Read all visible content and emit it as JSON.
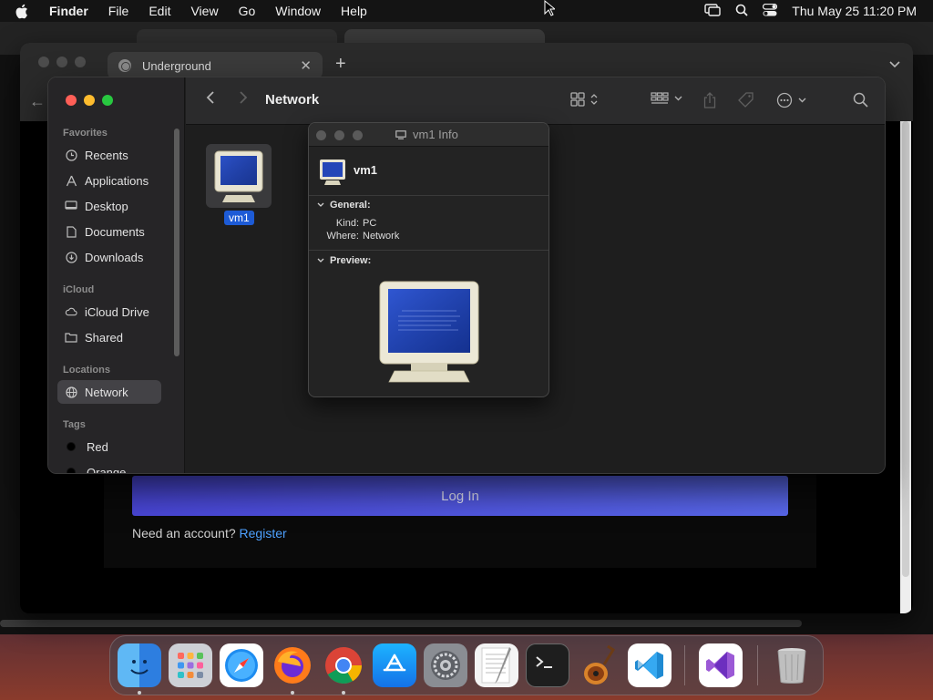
{
  "menubar": {
    "app_name": "Finder",
    "menus": [
      "File",
      "Edit",
      "View",
      "Go",
      "Window",
      "Help"
    ],
    "clock": "Thu May 25  11:20 PM"
  },
  "browser": {
    "tab_title": "Underground",
    "login_button": "Log In",
    "need_account": "Need an account?",
    "register_link": "Register"
  },
  "finder": {
    "title": "Network",
    "sidebar": {
      "favorites_heading": "Favorites",
      "favorites": [
        "Recents",
        "Applications",
        "Desktop",
        "Documents",
        "Downloads"
      ],
      "icloud_heading": "iCloud",
      "icloud": [
        "iCloud Drive",
        "Shared"
      ],
      "locations_heading": "Locations",
      "locations": [
        "Network"
      ],
      "tags_heading": "Tags",
      "tags": [
        {
          "label": "Red",
          "color": "#000000"
        },
        {
          "label": "Orange",
          "color": "#000000"
        }
      ]
    },
    "item_label": "vm1"
  },
  "info": {
    "title": "vm1 Info",
    "name": "vm1",
    "general_heading": "General:",
    "kind_key": "Kind:",
    "kind_value": "PC",
    "where_key": "Where:",
    "where_value": "Network",
    "preview_heading": "Preview:"
  },
  "dock": {
    "apps": [
      "Finder",
      "Launchpad",
      "Safari",
      "Firefox",
      "Chrome",
      "App Store",
      "System Settings",
      "TextEdit",
      "Terminal",
      "GarageBand",
      "Visual Studio Code",
      "Visual Studio",
      "Trash"
    ]
  },
  "colors": {
    "selection_blue": "#1d5bd6",
    "login_button": "#4a47d9",
    "link": "#4ea1ff"
  }
}
